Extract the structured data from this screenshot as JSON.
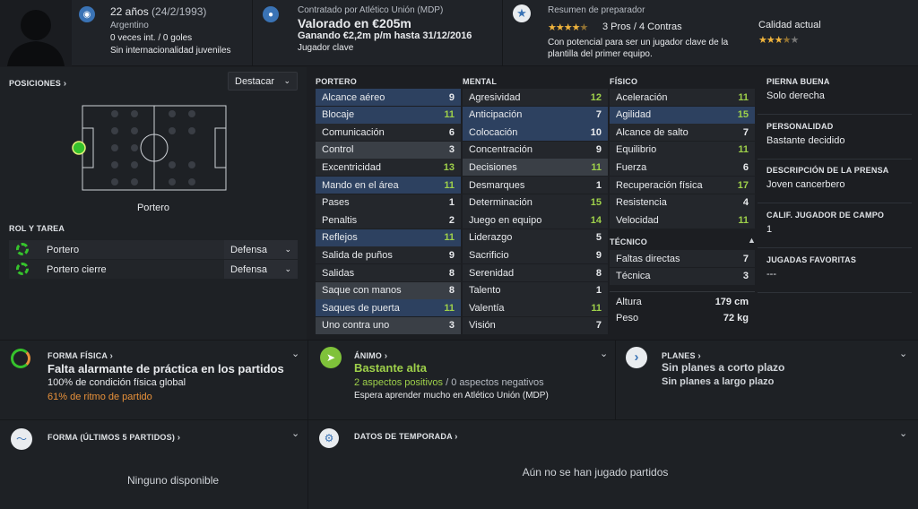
{
  "header": {
    "age": "22 años",
    "birth": "(24/2/1993)",
    "nationality": "Argentino",
    "caps": "0 veces int. / 0 goles",
    "youth_caps": "Sin internacionalidad juveniles",
    "contract_by": "Contratado por Atlético Unión (MDP)",
    "value": "Valorado en €205m",
    "wage": "Ganando €2,2m p/m hasta 31/12/2016",
    "squad_role": "Jugador clave",
    "scout_title": "Resumen de preparador",
    "pros_cons": "3 Pros / 4 Contras",
    "scout_text": "Con potencial para ser un jugador clave de la plantilla del primer equipo.",
    "quality_label": "Calidad actual",
    "pros_stars": 4.5,
    "quality_stars": 3.5
  },
  "positions": {
    "title": "POSICIONES",
    "highlight_button": "Destacar",
    "selected_position": "Portero",
    "role_title": "ROL Y TAREA",
    "roles": [
      {
        "name": "Portero",
        "duty": "Defensa"
      },
      {
        "name": "Portero cierre",
        "duty": "Defensa"
      }
    ]
  },
  "attributes": {
    "gk_title": "PORTERO",
    "goalkeeping": [
      {
        "name": "Alcance aéreo",
        "value": "9",
        "hl": "hl",
        "c": "w"
      },
      {
        "name": "Blocaje",
        "value": "11",
        "hl": "hl",
        "c": "g"
      },
      {
        "name": "Comunicación",
        "value": "6",
        "hl": "",
        "c": "w"
      },
      {
        "name": "Control",
        "value": "3",
        "hl": "gr",
        "c": "w"
      },
      {
        "name": "Excentricidad",
        "value": "13",
        "hl": "",
        "c": "g"
      },
      {
        "name": "Mando en el área",
        "value": "11",
        "hl": "hl",
        "c": "g"
      },
      {
        "name": "Pases",
        "value": "1",
        "hl": "",
        "c": "w"
      },
      {
        "name": "Penaltis",
        "value": "2",
        "hl": "",
        "c": "w"
      },
      {
        "name": "Reflejos",
        "value": "11",
        "hl": "hl",
        "c": "g"
      },
      {
        "name": "Salida de puños",
        "value": "9",
        "hl": "",
        "c": "w"
      },
      {
        "name": "Salidas",
        "value": "8",
        "hl": "",
        "c": "w"
      },
      {
        "name": "Saque con manos",
        "value": "8",
        "hl": "gr",
        "c": "w"
      },
      {
        "name": "Saques de puerta",
        "value": "11",
        "hl": "hl",
        "c": "g"
      },
      {
        "name": "Uno contra uno",
        "value": "3",
        "hl": "gr",
        "c": "w"
      }
    ],
    "mental_title": "MENTAL",
    "mental": [
      {
        "name": "Agresividad",
        "value": "12",
        "hl": "",
        "c": "g"
      },
      {
        "name": "Anticipación",
        "value": "7",
        "hl": "hl",
        "c": "w"
      },
      {
        "name": "Colocación",
        "value": "10",
        "hl": "hl",
        "c": "w"
      },
      {
        "name": "Concentración",
        "value": "9",
        "hl": "",
        "c": "w"
      },
      {
        "name": "Decisiones",
        "value": "11",
        "hl": "gr",
        "c": "g"
      },
      {
        "name": "Desmarques",
        "value": "1",
        "hl": "",
        "c": "w"
      },
      {
        "name": "Determinación",
        "value": "15",
        "hl": "",
        "c": "g"
      },
      {
        "name": "Juego en equipo",
        "value": "14",
        "hl": "",
        "c": "g"
      },
      {
        "name": "Liderazgo",
        "value": "5",
        "hl": "",
        "c": "w"
      },
      {
        "name": "Sacrificio",
        "value": "9",
        "hl": "",
        "c": "w"
      },
      {
        "name": "Serenidad",
        "value": "8",
        "hl": "",
        "c": "w"
      },
      {
        "name": "Talento",
        "value": "1",
        "hl": "",
        "c": "w"
      },
      {
        "name": "Valentía",
        "value": "11",
        "hl": "",
        "c": "g"
      },
      {
        "name": "Visión",
        "value": "7",
        "hl": "",
        "c": "w"
      }
    ],
    "physical_title": "FÍSICO",
    "physical": [
      {
        "name": "Aceleración",
        "value": "11",
        "hl": "",
        "c": "g"
      },
      {
        "name": "Agilidad",
        "value": "15",
        "hl": "hl",
        "c": "g"
      },
      {
        "name": "Alcance de salto",
        "value": "7",
        "hl": "",
        "c": "w"
      },
      {
        "name": "Equilibrio",
        "value": "11",
        "hl": "",
        "c": "g"
      },
      {
        "name": "Fuerza",
        "value": "6",
        "hl": "",
        "c": "w"
      },
      {
        "name": "Recuperación física",
        "value": "17",
        "hl": "",
        "c": "g"
      },
      {
        "name": "Resistencia",
        "value": "4",
        "hl": "",
        "c": "w"
      },
      {
        "name": "Velocidad",
        "value": "11",
        "hl": "",
        "c": "g"
      }
    ],
    "technical_title": "TÉCNICO",
    "technical": [
      {
        "name": "Faltas directas",
        "value": "7",
        "hl": "",
        "c": "w"
      },
      {
        "name": "Técnica",
        "value": "3",
        "hl": "",
        "c": "w"
      }
    ],
    "height_label": "Altura",
    "height": "179 cm",
    "weight_label": "Peso",
    "weight": "72 kg"
  },
  "info": [
    {
      "label": "PIERNA BUENA",
      "value": "Solo derecha"
    },
    {
      "label": "PERSONALIDAD",
      "value": "Bastante decidido"
    },
    {
      "label": "DESCRIPCIÓN DE LA PRENSA",
      "value": "Joven cancerbero"
    },
    {
      "label": "CALIF. JUGADOR DE CAMPO",
      "value": "1"
    },
    {
      "label": "JUGADAS FAVORITAS",
      "value": "---"
    }
  ],
  "fitness": {
    "title": "FORMA FÍSICA",
    "headline": "Falta alarmante de práctica en los partidos",
    "line1": "100% de condición física global",
    "line2": "61% de ritmo de partido",
    "match_sharpness": 0.61
  },
  "morale": {
    "title": "ÁNIMO",
    "headline": "Bastante alta",
    "positives": "2 aspectos positivos",
    "separator": " / ",
    "negatives": "0 aspectos negativos",
    "line2": "Espera aprender mucho en Atlético Unión (MDP)"
  },
  "plans": {
    "title": "PLANES",
    "short": "Sin planes a corto plazo",
    "long": "Sin planes a largo plazo"
  },
  "form": {
    "title": "FORMA (ÚLTIMOS 5 PARTIDOS)",
    "empty": "Ninguno disponible"
  },
  "season": {
    "title": "DATOS DE TEMPORADA",
    "empty": "Aún no se han jugado partidos"
  },
  "colors": {
    "accent_green": "#9ed04a",
    "highlight_blue": "#2d4160",
    "orange": "#e8913a"
  }
}
